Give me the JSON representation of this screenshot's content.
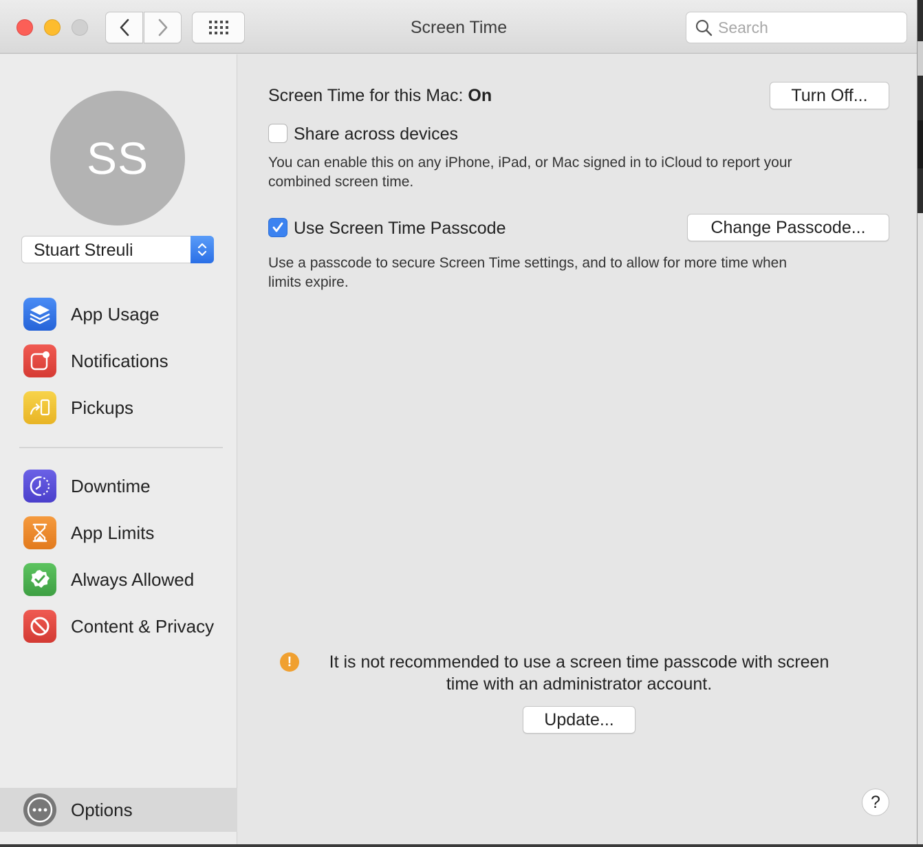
{
  "window": {
    "title": "Screen Time",
    "search_placeholder": "Search"
  },
  "sidebar": {
    "avatar_initials": "SS",
    "user": "Stuart Streuli",
    "group1": [
      {
        "label": "App Usage",
        "icon": "layers-icon",
        "color": "#2f6fe0"
      },
      {
        "label": "Notifications",
        "icon": "notification-icon",
        "color": "#e0403a"
      },
      {
        "label": "Pickups",
        "icon": "pickups-icon",
        "color": "#f1c232"
      }
    ],
    "group2": [
      {
        "label": "Downtime",
        "icon": "downtime-icon",
        "color": "#5b4fd8"
      },
      {
        "label": "App Limits",
        "icon": "hourglass-icon",
        "color": "#ef8a2a"
      },
      {
        "label": "Always Allowed",
        "icon": "checkmark-badge-icon",
        "color": "#4caf50"
      },
      {
        "label": "Content & Privacy",
        "icon": "prohibited-icon",
        "color": "#e0403a"
      }
    ],
    "options_label": "Options"
  },
  "main": {
    "status_prefix": "Screen Time for this Mac:",
    "status_value": "On",
    "turn_off_label": "Turn Off...",
    "share_label": "Share across devices",
    "share_checked": false,
    "share_desc_line1": "You can enable this on any iPhone, iPad, or Mac signed in to iCloud to report your",
    "share_desc_line2": "combined screen time.",
    "passcode_label": "Use Screen Time Passcode",
    "passcode_checked": true,
    "change_passcode_label": "Change Passcode...",
    "passcode_desc_line1": "Use a passcode to secure Screen Time settings, and to allow for more time when",
    "passcode_desc_line2": "limits expire.",
    "warning_line1": "It is not recommended to use a screen time passcode with screen",
    "warning_line2": "time with an administrator account.",
    "update_label": "Update...",
    "help_label": "?"
  },
  "colors": {
    "accent": "#3b82f0",
    "warning": "#f0a030"
  }
}
